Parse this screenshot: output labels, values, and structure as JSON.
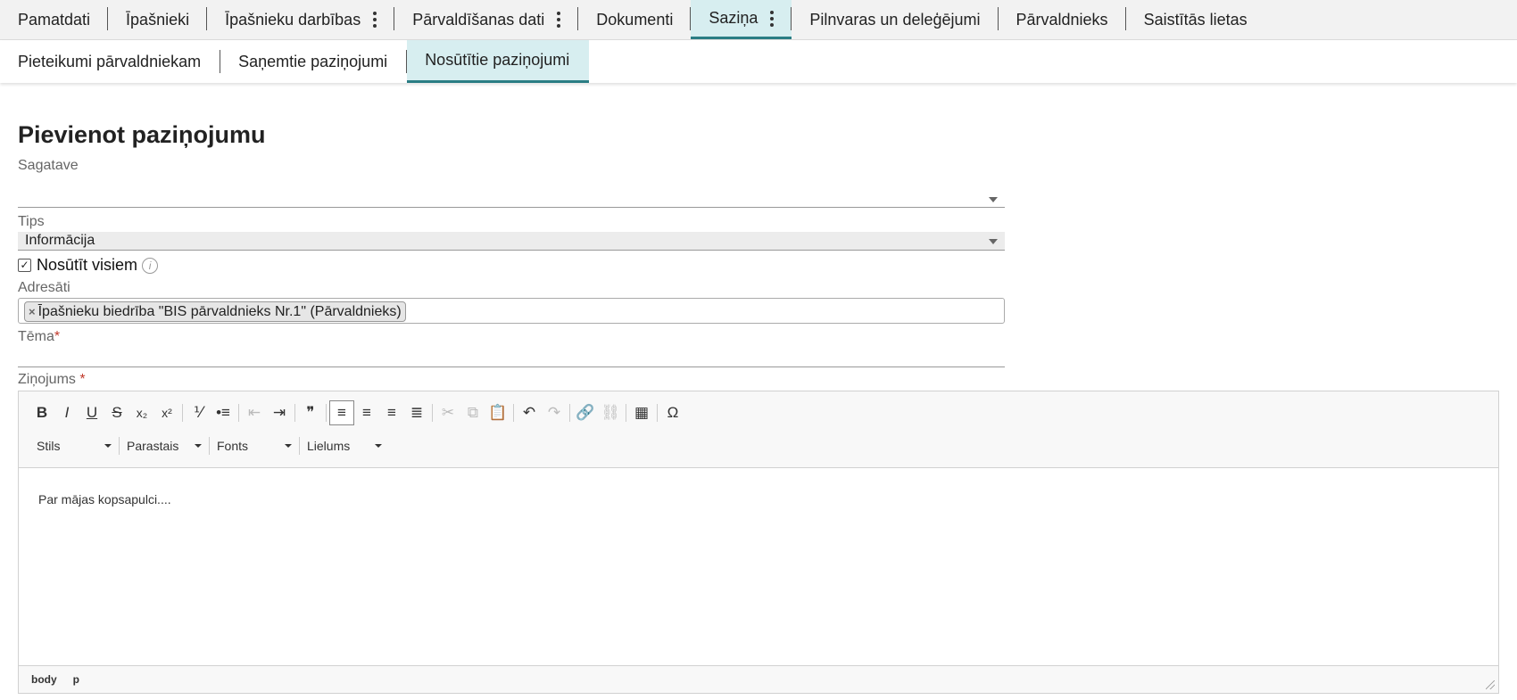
{
  "top_tabs": [
    {
      "label": "Pamatdati",
      "menu": false,
      "active": false
    },
    {
      "label": "Īpašnieki",
      "menu": false,
      "active": false
    },
    {
      "label": "Īpašnieku darbības",
      "menu": true,
      "active": false
    },
    {
      "label": "Pārvaldīšanas dati",
      "menu": true,
      "active": false
    },
    {
      "label": "Dokumenti",
      "menu": false,
      "active": false
    },
    {
      "label": "Saziņa",
      "menu": true,
      "active": true
    },
    {
      "label": "Pilnvaras un deleģējumi",
      "menu": false,
      "active": false
    },
    {
      "label": "Pārvaldnieks",
      "menu": false,
      "active": false
    },
    {
      "label": "Saistītās lietas",
      "menu": false,
      "active": false
    }
  ],
  "sub_tabs": [
    {
      "label": "Pieteikumi pārvaldniekam",
      "active": false
    },
    {
      "label": "Saņemtie paziņojumi",
      "active": false
    },
    {
      "label": "Nosūtītie paziņojumi",
      "active": true
    }
  ],
  "form": {
    "title": "Pievienot paziņojumu",
    "template_label": "Sagatave",
    "template_value": "",
    "type_label": "Tips",
    "type_value": "Informācija",
    "send_all_label": "Nosūtīt visiem",
    "send_all_checked": true,
    "recipients_label": "Adresāti",
    "recipients": [
      "Īpašnieku biedrība \"BIS pārvaldnieks Nr.1\" (Pārvaldnieks)"
    ],
    "subject_label": "Tēma",
    "subject_value": "",
    "message_label": "Ziņojums",
    "required_mark": "*"
  },
  "editor": {
    "toolbar": [
      {
        "name": "bold-icon",
        "glyph": "B",
        "disabled": false
      },
      {
        "name": "italic-icon",
        "glyph": "I",
        "disabled": false
      },
      {
        "name": "underline-icon",
        "glyph": "U",
        "disabled": false
      },
      {
        "name": "strikethrough-icon",
        "glyph": "S",
        "disabled": false
      },
      {
        "name": "subscript-icon",
        "glyph": "x₂",
        "disabled": false
      },
      {
        "name": "superscript-icon",
        "glyph": "x²",
        "disabled": false
      },
      {
        "sep": true
      },
      {
        "name": "numbered-list-icon",
        "glyph": "⅟",
        "disabled": false
      },
      {
        "name": "bulleted-list-icon",
        "glyph": "•≡",
        "disabled": false
      },
      {
        "sep": true
      },
      {
        "name": "outdent-icon",
        "glyph": "⇤",
        "disabled": true
      },
      {
        "name": "indent-icon",
        "glyph": "⇥",
        "disabled": false
      },
      {
        "sep": true
      },
      {
        "name": "blockquote-icon",
        "glyph": "❞",
        "disabled": false
      },
      {
        "sep": true
      },
      {
        "name": "align-left-icon",
        "glyph": "≡",
        "disabled": false,
        "pressed": true
      },
      {
        "name": "align-center-icon",
        "glyph": "≡",
        "disabled": false
      },
      {
        "name": "align-right-icon",
        "glyph": "≡",
        "disabled": false
      },
      {
        "name": "justify-icon",
        "glyph": "≣",
        "disabled": false
      },
      {
        "sep": true
      },
      {
        "name": "cut-icon",
        "glyph": "✂",
        "disabled": true
      },
      {
        "name": "copy-icon",
        "glyph": "⧉",
        "disabled": true
      },
      {
        "name": "paste-icon",
        "glyph": "📋",
        "disabled": false
      },
      {
        "sep": true
      },
      {
        "name": "undo-icon",
        "glyph": "↶",
        "disabled": false
      },
      {
        "name": "redo-icon",
        "glyph": "↷",
        "disabled": true
      },
      {
        "sep": true
      },
      {
        "name": "link-icon",
        "glyph": "🔗",
        "disabled": false
      },
      {
        "name": "unlink-icon",
        "glyph": "⛓",
        "disabled": true
      },
      {
        "sep": true
      },
      {
        "name": "table-icon",
        "glyph": "▦",
        "disabled": false
      },
      {
        "sep": true
      },
      {
        "name": "special-char-icon",
        "glyph": "Ω",
        "disabled": false
      }
    ],
    "combos": [
      {
        "name": "style-combo",
        "label": "Stils"
      },
      {
        "name": "format-combo",
        "label": "Parastais"
      },
      {
        "name": "font-combo",
        "label": "Fonts"
      },
      {
        "name": "size-combo",
        "label": "Lielums"
      }
    ],
    "content": "Par mājas kopsapulci....",
    "path": [
      "body",
      "p"
    ]
  }
}
